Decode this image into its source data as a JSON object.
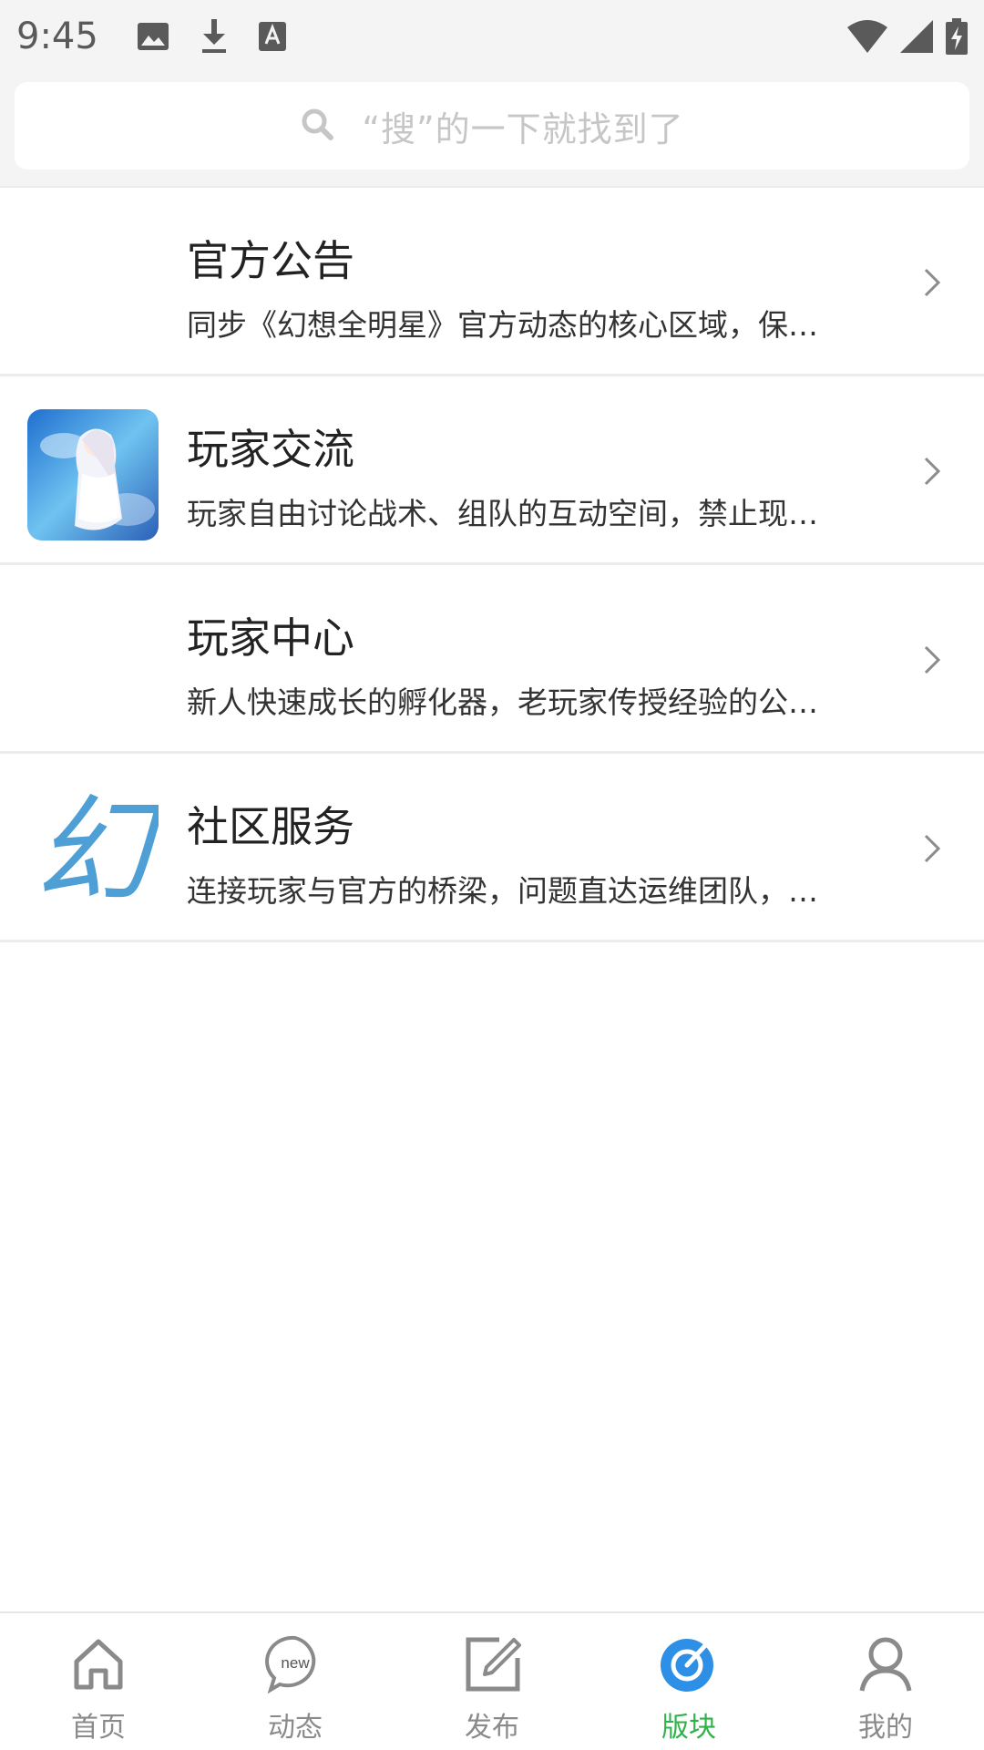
{
  "status_bar": {
    "time": "9:45",
    "left_icons": [
      "image-icon",
      "download-icon",
      "text-a-icon"
    ],
    "right_icons": [
      "wifi-icon",
      "signal-icon",
      "battery-charging-icon"
    ]
  },
  "search": {
    "placeholder": "“搜”的一下就找到了",
    "icon": "search-icon"
  },
  "forums": [
    {
      "title": "官方公告",
      "description": "同步《幻想全明星》官方动态的核心区域，保…",
      "thumb": "none"
    },
    {
      "title": "玩家交流",
      "description": "玩家自由讨论战术、组队的互动空间，禁止现…",
      "thumb": "anime-girl-image"
    },
    {
      "title": "玩家中心",
      "description": "新人快速成长的孵化器，老玩家传授经验的公…",
      "thumb": "none"
    },
    {
      "title": "社区服务",
      "description": "连接玩家与官方的桥梁，问题直达运维团队，…",
      "thumb": "calligraphy-logo",
      "thumb_glyph": "幻"
    }
  ],
  "tabbar": {
    "tabs": [
      {
        "label": "首页",
        "icon": "home-icon",
        "active": false
      },
      {
        "label": "动态",
        "icon": "new-bubble-icon",
        "icon_text": "new",
        "active": false
      },
      {
        "label": "发布",
        "icon": "edit-icon",
        "active": false
      },
      {
        "label": "版块",
        "icon": "compass-target-icon",
        "active": true
      },
      {
        "label": "我的",
        "icon": "user-icon",
        "active": false
      }
    ],
    "active_color": "#2fb24a",
    "inactive_color": "#8a8a8a",
    "active_icon_color": "#2d8fe6"
  }
}
